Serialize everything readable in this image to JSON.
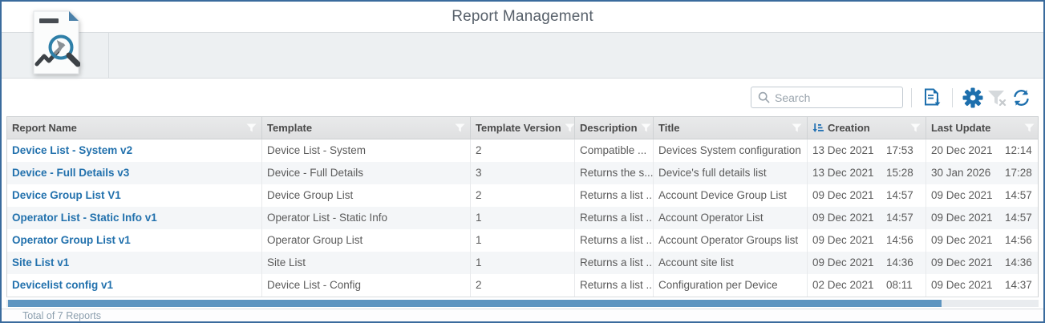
{
  "window": {
    "title": "Report Management"
  },
  "toolbar": {
    "search": {
      "placeholder": "Search"
    },
    "buttons": [
      {
        "name": "export-report",
        "icon": "document-export-icon",
        "enabled": true
      },
      {
        "name": "settings",
        "icon": "gear-icon",
        "enabled": true
      },
      {
        "name": "clear-filters",
        "icon": "filter-clear-icon",
        "enabled": false
      },
      {
        "name": "refresh",
        "icon": "refresh-icon",
        "enabled": true
      }
    ]
  },
  "table": {
    "columns": [
      {
        "label": "Report Name",
        "has_filter": true,
        "sorted": false
      },
      {
        "label": "Template",
        "has_filter": true,
        "sorted": false
      },
      {
        "label": "Template Version",
        "has_filter": true,
        "sorted": false
      },
      {
        "label": "Description",
        "has_filter": true,
        "sorted": false
      },
      {
        "label": "Title",
        "has_filter": true,
        "sorted": false
      },
      {
        "label": "Creation",
        "has_filter": true,
        "sorted": true
      },
      {
        "label": "Last Update",
        "has_filter": true,
        "sorted": false
      }
    ],
    "rows": [
      {
        "name": "Device List - System v2",
        "template": "Device List - System",
        "version": "2",
        "description": "Compatible ...",
        "title": "Devices System configuration",
        "creation_date": "13 Dec 2021",
        "creation_time": "17:53",
        "update_date": "20 Dec 2021",
        "update_time": "12:14"
      },
      {
        "name": "Device - Full Details v3",
        "template": "Device - Full Details",
        "version": "3",
        "description": "Returns the s...",
        "title": "Device's full details list",
        "creation_date": "13 Dec 2021",
        "creation_time": "15:28",
        "update_date": "30 Jan 2026",
        "update_time": "17:28"
      },
      {
        "name": "Device Group List V1",
        "template": "Device Group List",
        "version": "2",
        "description": "Returns a list ...",
        "title": "Account Device Group List",
        "creation_date": "09 Dec 2021",
        "creation_time": "14:57",
        "update_date": "09 Dec 2021",
        "update_time": "14:57"
      },
      {
        "name": "Operator List - Static Info v1",
        "template": "Operator List - Static Info",
        "version": "1",
        "description": "Returns a list ...",
        "title": "Account Operator List",
        "creation_date": "09 Dec 2021",
        "creation_time": "14:57",
        "update_date": "09 Dec 2021",
        "update_time": "14:57"
      },
      {
        "name": "Operator Group List v1",
        "template": "Operator Group List",
        "version": "1",
        "description": "Returns a list ...",
        "title": "Account Operator Groups list",
        "creation_date": "09 Dec 2021",
        "creation_time": "14:56",
        "update_date": "09 Dec 2021",
        "update_time": "14:56"
      },
      {
        "name": "Site List v1",
        "template": "Site List",
        "version": "1",
        "description": "Returns a list ...",
        "title": "Account site list",
        "creation_date": "09 Dec 2021",
        "creation_time": "14:36",
        "update_date": "09 Dec 2021",
        "update_time": "14:36"
      },
      {
        "name": "Devicelist config v1",
        "template": "Device List - Config",
        "version": "2",
        "description": "Returns a list ...",
        "title": "Configuration per Device",
        "creation_date": "02 Dec 2021",
        "creation_time": "08:11",
        "update_date": "09 Dec 2021",
        "update_time": "14:37"
      }
    ]
  },
  "footer": {
    "total_label": "Total of 7 Reports"
  },
  "colors": {
    "accent_blue": "#1d6fad",
    "link_blue": "#2271ad",
    "frame_border": "#3a6b9d",
    "scrollbar_thumb": "#5e95c0"
  }
}
